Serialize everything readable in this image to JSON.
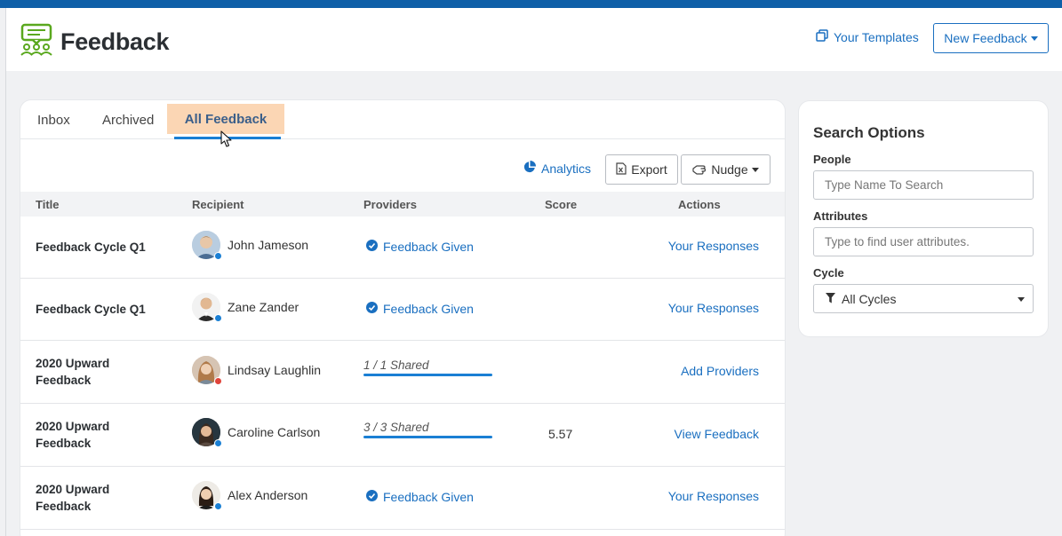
{
  "header": {
    "app_title": "Feedback",
    "templates_label": "Your Templates",
    "new_feedback_label": "New Feedback"
  },
  "tabs": [
    {
      "label": "Inbox",
      "active": false
    },
    {
      "label": "Archived",
      "active": false
    },
    {
      "label": "All Feedback",
      "active": true
    }
  ],
  "toolbar": {
    "analytics_label": "Analytics",
    "export_label": "Export",
    "nudge_label": "Nudge"
  },
  "table": {
    "columns": [
      "Title",
      "Recipient",
      "Providers",
      "Score",
      "Actions"
    ],
    "rows": [
      {
        "title": "Feedback Cycle Q1",
        "recipient": "John Jameson",
        "provider": "Feedback Given",
        "shared": null,
        "score": "",
        "action": "Your Responses",
        "status": "blue"
      },
      {
        "title": "Feedback Cycle Q1",
        "recipient": "Zane Zander",
        "provider": "Feedback Given",
        "shared": null,
        "score": "",
        "action": "Your Responses",
        "status": "blue"
      },
      {
        "title": "2020 Upward Feedback",
        "recipient": "Lindsay Laughlin",
        "provider": "",
        "shared": "1 / 1 Shared",
        "score": "",
        "action": "Add Providers",
        "status": "red"
      },
      {
        "title": "2020 Upward Feedback",
        "recipient": "Caroline Carlson",
        "provider": "",
        "shared": "3 / 3 Shared",
        "score": "5.57",
        "action": "View Feedback",
        "status": "blue"
      },
      {
        "title": "2020 Upward Feedback",
        "recipient": "Alex Anderson",
        "provider": "Feedback Given",
        "shared": null,
        "score": "",
        "action": "Your Responses",
        "status": "blue"
      }
    ]
  },
  "search": {
    "title": "Search Options",
    "people_label": "People",
    "people_placeholder": "Type Name To Search",
    "attributes_label": "Attributes",
    "attributes_placeholder": "Type to find user attributes.",
    "cycle_label": "Cycle",
    "cycle_value": "All Cycles"
  },
  "colors": {
    "accent": "#1a6fc0",
    "top_stripe": "#0f5fa8",
    "active_tab_bg": "#fbd6b4",
    "status_blue": "#1a7fd4",
    "status_red": "#e0433a",
    "logo_green": "#5aa81e"
  }
}
